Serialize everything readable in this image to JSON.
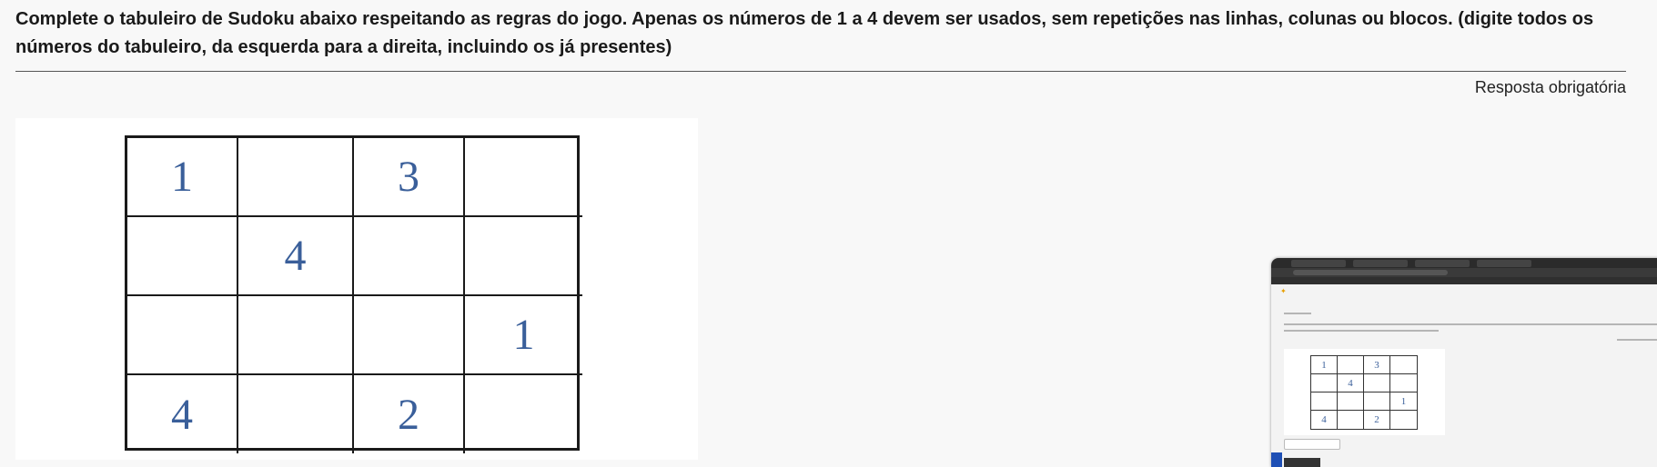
{
  "question": {
    "text": "Complete o tabuleiro de Sudoku abaixo respeitando as regras do jogo. Apenas os números de 1 a 4 devem ser usados, sem repetições nas linhas, colunas ou blocos. (digite todos os números do tabuleiro, da esquerda para a direita, incluindo os já presentes)",
    "required_label": "Resposta obrigatória"
  },
  "sudoku": {
    "rows": [
      [
        "1",
        "",
        "3",
        ""
      ],
      [
        "",
        "4",
        "",
        ""
      ],
      [
        "",
        "",
        "",
        "1"
      ],
      [
        "4",
        "",
        "2",
        ""
      ]
    ],
    "digit_color": "#3a5f9a"
  },
  "thumbnail": {
    "rows": [
      [
        "1",
        "",
        "3",
        ""
      ],
      [
        "",
        "4",
        "",
        ""
      ],
      [
        "",
        "",
        "",
        "1"
      ],
      [
        "4",
        "",
        "2",
        ""
      ]
    ]
  }
}
